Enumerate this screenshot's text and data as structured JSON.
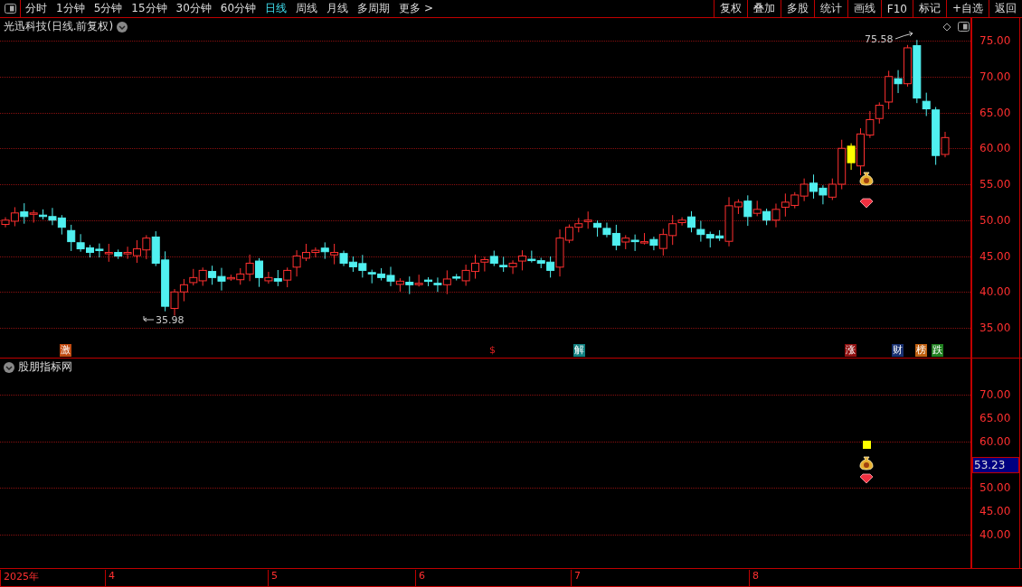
{
  "toolbar": {
    "periods": [
      {
        "label": "分时",
        "selected": false
      },
      {
        "label": "1分钟",
        "selected": false
      },
      {
        "label": "5分钟",
        "selected": false
      },
      {
        "label": "15分钟",
        "selected": false
      },
      {
        "label": "30分钟",
        "selected": false
      },
      {
        "label": "60分钟",
        "selected": false
      },
      {
        "label": "日线",
        "selected": true
      },
      {
        "label": "周线",
        "selected": false
      },
      {
        "label": "月线",
        "selected": false
      },
      {
        "label": "多周期",
        "selected": false
      },
      {
        "label": "更多 >",
        "selected": false
      }
    ],
    "actions": [
      "复权",
      "叠加",
      "多股",
      "统计",
      "画线",
      "F10",
      "标记",
      "+自选",
      "返回"
    ]
  },
  "main_pane": {
    "title": "光迅科技(日线.前复权)",
    "high_label": "75.58",
    "low_label": "35.98",
    "y_axis": [
      "75.00",
      "70.00",
      "65.00",
      "60.00",
      "55.00",
      "50.00",
      "45.00",
      "40.00",
      "35.00"
    ],
    "markers": [
      {
        "label": "激",
        "kind": "tag",
        "color": "#c04a10"
      },
      {
        "label": "$",
        "kind": "glyph",
        "color": "#e02020"
      },
      {
        "label": "解",
        "kind": "tag",
        "color": "#108080"
      },
      {
        "label": "涨",
        "kind": "tag",
        "color": "#901010"
      },
      {
        "label": "财",
        "kind": "tag",
        "color": "#183070"
      },
      {
        "label": "榜",
        "kind": "tag",
        "color": "#c06010"
      },
      {
        "label": "跌",
        "kind": "tag",
        "color": "#208020"
      }
    ]
  },
  "indicator_pane": {
    "title": "股朋指标网",
    "y_axis": [
      "70.00",
      "65.00",
      "60.00",
      "50.00",
      "45.00",
      "40.00"
    ],
    "current_value": "53.23"
  },
  "time_axis": [
    "2025年",
    "4",
    "5",
    "6",
    "7",
    "8"
  ]
}
